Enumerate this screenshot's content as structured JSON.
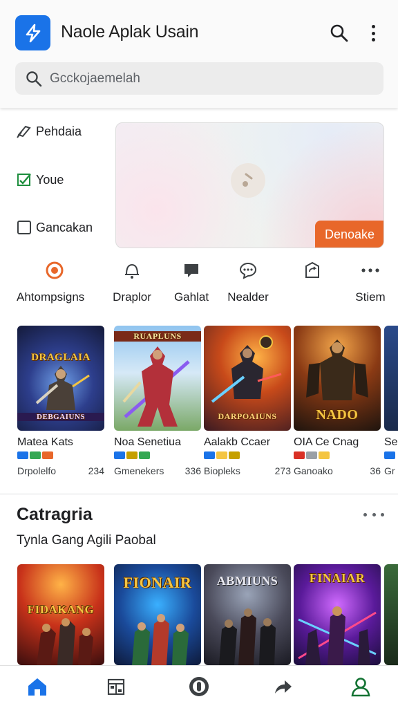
{
  "header": {
    "app_title": "Naole Aplak Usain",
    "search_placeholder": "Gcckojaemelah",
    "icons": [
      "bolt-icon",
      "search-icon",
      "more-vert-icon"
    ]
  },
  "filters": [
    {
      "label": "Pehdaia",
      "icon": "tag-icon"
    },
    {
      "label": "Youe",
      "icon": "check-square-icon"
    },
    {
      "label": "Gancakan",
      "icon": "empty-checkbox-icon"
    }
  ],
  "banner": {
    "button_label": "Denoake",
    "icon": "play-icon"
  },
  "categories": [
    {
      "label": "Ahtompsigns",
      "icon": "target-icon"
    },
    {
      "label": "Draplor",
      "icon": "bell-icon"
    },
    {
      "label": "Gahlat",
      "icon": "chat-bubble-icon"
    },
    {
      "label": "Nealder",
      "icon": "comment-icon"
    },
    {
      "label": "",
      "icon": "share-box-icon"
    },
    {
      "label": "Stiem",
      "icon": "more-horiz-icon"
    }
  ],
  "games": [
    {
      "art_title": "DRAGLAIA",
      "art_sub": "DEBGAIUNS",
      "name": "Matea Kats",
      "developer": "Drpolelfo",
      "count": "234"
    },
    {
      "art_title": "RUAPLUNS",
      "art_sub": "",
      "name": "Noa Senetiua",
      "developer": "Gmenekers",
      "count": "336"
    },
    {
      "art_title": "",
      "art_sub": "DARPOAIUNS",
      "name": "Aalakb Ccaer",
      "developer": "Biopleks",
      "count": "273"
    },
    {
      "art_title": "NADO",
      "art_sub": "",
      "name": "OIA Ce Cnag",
      "developer": "Ganoako",
      "count": "36"
    },
    {
      "art_title": "",
      "art_sub": "",
      "name": "Se",
      "developer": "Gr",
      "count": ""
    }
  ],
  "section": {
    "title": "Catragria",
    "subtitle": "Tynla Gang Agili Paobal"
  },
  "row2_art": [
    "FIDAKANG",
    "FIONAIR",
    "ABMIUNS",
    "FINAIAR"
  ],
  "bottom_nav": [
    "home-icon",
    "calendar-icon",
    "circle-badge-icon",
    "forward-arrow-icon",
    "profile-icon"
  ],
  "colors": {
    "accent": "#1a73e8",
    "banner_button": "#e8672a",
    "profile_green": "#137333"
  }
}
